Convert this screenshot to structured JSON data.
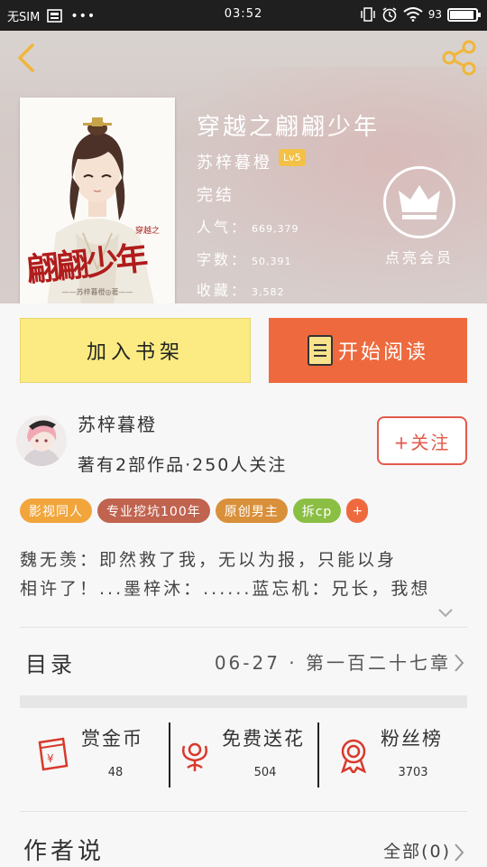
{
  "status_bar": {
    "carrier": "无SIM",
    "time": "03:52",
    "battery": "93",
    "battery_level": 0.93
  },
  "book": {
    "title": "穿越之翩翩少年",
    "author": "苏梓暮橙",
    "level_badge": "Lv5",
    "status": "完结",
    "stats": [
      {
        "label": "人气：",
        "value": "669,379"
      },
      {
        "label": "字数：",
        "value": "50,391"
      },
      {
        "label": "收藏：",
        "value": "3,582"
      }
    ],
    "cover": {
      "subtitle": "穿越之",
      "title_art": "翩翩少年",
      "byline": "——苏梓暮橙◎著——"
    }
  },
  "vip": {
    "label": "点亮会员",
    "icon": "crown-icon"
  },
  "actions": {
    "add_shelf": "加入书架",
    "start_read": "开始阅读"
  },
  "author_card": {
    "name": "苏梓暮橙",
    "meta": "著有2部作品·250人关注",
    "follow": "+关注"
  },
  "tags": [
    {
      "label": "影视同人",
      "color": "#f1a53b"
    },
    {
      "label": "专业挖坑100年",
      "color": "#c0634f"
    },
    {
      "label": "原创男主",
      "color": "#d9903a"
    },
    {
      "label": "拆cp",
      "color": "#8bbf44"
    }
  ],
  "tag_more": "+",
  "intro": {
    "line1": "魏无羡：即然救了我，无以为报，只能以身",
    "line2": "相许了！...墨梓沐：......蓝忘机：兄长，我想"
  },
  "catalog": {
    "label": "目录",
    "latest": "06-27 · 第一百二十七章"
  },
  "support": [
    {
      "label": "赏金币",
      "count": "48",
      "icon": "red-envelope-icon"
    },
    {
      "label": "免费送花",
      "count": "504",
      "icon": "flower-icon"
    },
    {
      "label": "粉丝榜",
      "count": "3703",
      "icon": "medal-icon"
    }
  ],
  "author_says": {
    "label": "作者说",
    "all": "全部(0)"
  }
}
